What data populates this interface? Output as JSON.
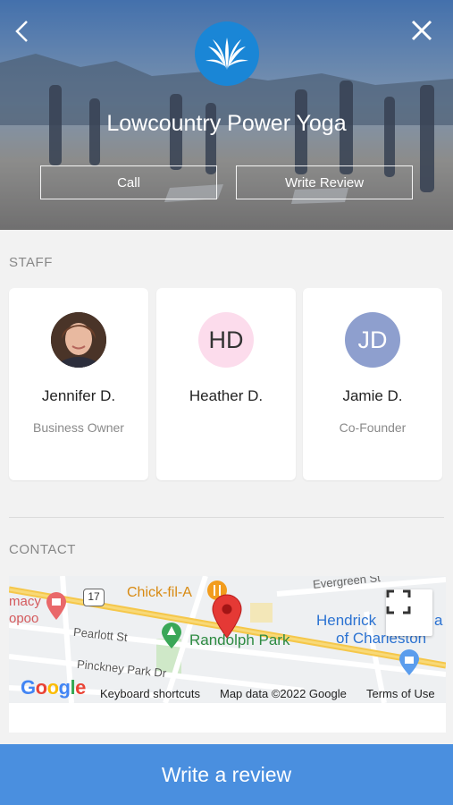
{
  "header": {
    "business_name": "Lowcountry Power Yoga",
    "call_label": "Call",
    "write_review_label": "Write Review"
  },
  "staff": {
    "title": "STAFF",
    "members": [
      {
        "name": "Jennifer D.",
        "role": "Business Owner",
        "initials": ""
      },
      {
        "name": "Heather D.",
        "role": "",
        "initials": "HD"
      },
      {
        "name": "Jamie D.",
        "role": "Co-Founder",
        "initials": "JD"
      }
    ]
  },
  "contact": {
    "title": "CONTACT",
    "map": {
      "labels": {
        "chick": "Chick-fil-A",
        "randolph": "Randolph Park",
        "pearlott": "Pearlott St",
        "pinckney": "Pinckney Park Dr",
        "evergreen": "Evergreen St",
        "hendrick1": "Hendrick",
        "hendrick2": "a",
        "charleston": "of Charleston",
        "pharm1": "macy",
        "pharm2": "opoo",
        "route": "17"
      },
      "google": "Google",
      "keyboard_shortcuts": "Keyboard shortcuts",
      "map_data": "Map data ©2022 Google",
      "terms": "Terms of Use"
    }
  },
  "footer": {
    "write_review": "Write a review"
  },
  "colors": {
    "accent": "#4a8fdf",
    "logo_bg": "#1a86d6",
    "hd_avatar": "#fcdcec",
    "jd_avatar": "#8e9fce"
  }
}
